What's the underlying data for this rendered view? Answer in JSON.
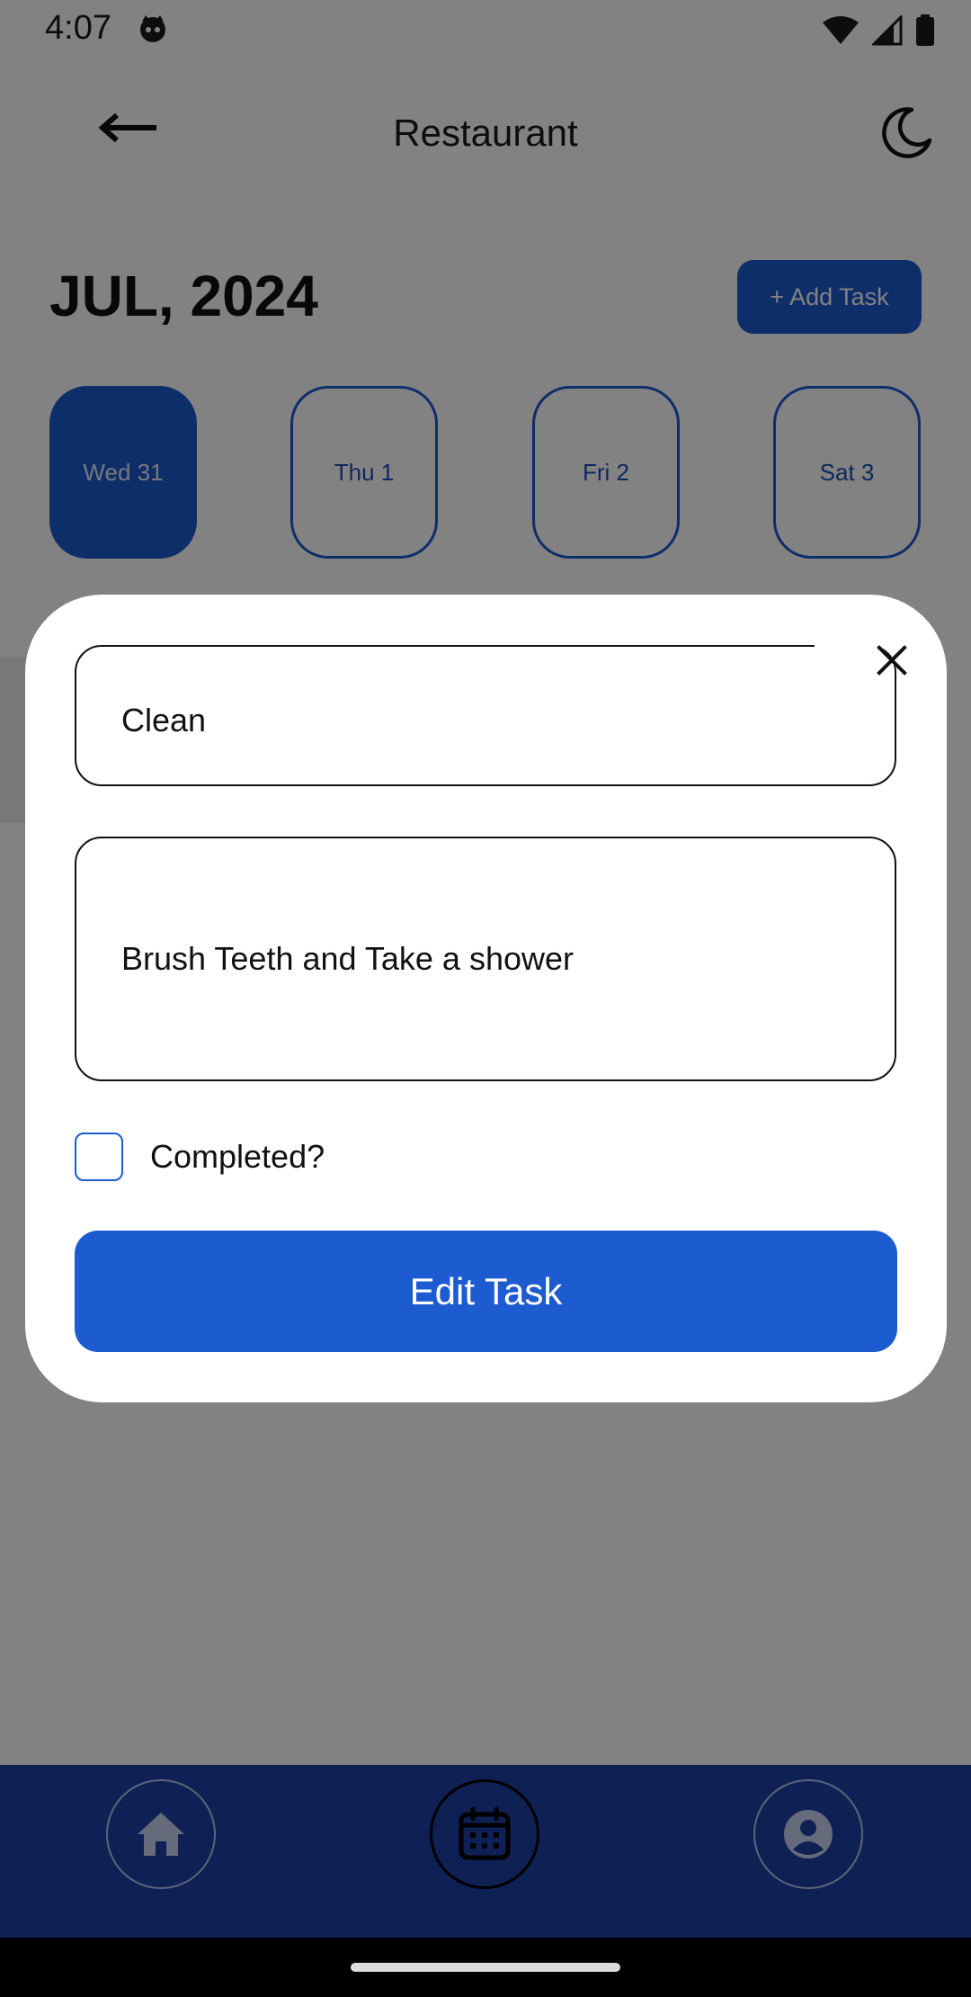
{
  "status_bar": {
    "time": "4:07"
  },
  "header": {
    "title": "Restaurant",
    "back_icon": "arrow-left-icon",
    "theme_icon": "moon-icon"
  },
  "calendar": {
    "month_label": "JUL, 2024",
    "add_task_label": "+ Add Task",
    "days": [
      {
        "label": "Wed 31",
        "selected": true
      },
      {
        "label": "Thu 1",
        "selected": false
      },
      {
        "label": "Fri 2",
        "selected": false
      },
      {
        "label": "Sat 3",
        "selected": false
      }
    ]
  },
  "dialog": {
    "title_value": "Clean",
    "description_value": "Brush Teeth and Take a shower",
    "completed_label": "Completed?",
    "completed_checked": false,
    "submit_label": "Edit Task",
    "close_icon": "close-icon"
  },
  "bottom_nav": {
    "items": [
      {
        "icon": "home-icon",
        "active": false
      },
      {
        "icon": "calendar-icon",
        "active": true
      },
      {
        "icon": "account-icon",
        "active": false
      }
    ]
  },
  "colors": {
    "primary": "#1d5bd1",
    "nav_background": "#1e3fa8",
    "scrim": "rgba(0,0,0,0.49)"
  }
}
